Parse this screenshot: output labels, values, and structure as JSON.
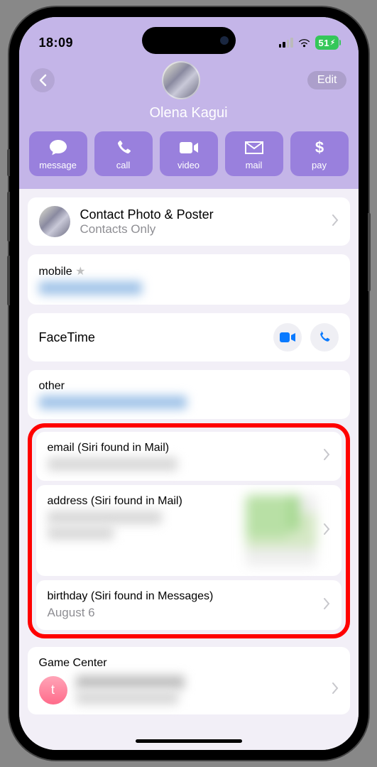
{
  "status": {
    "time": "18:09",
    "battery": "51"
  },
  "header": {
    "edit_label": "Edit",
    "contact_name": "Olena Kagui"
  },
  "actions": {
    "message": "message",
    "call": "call",
    "video": "video",
    "mail": "mail",
    "pay": "pay"
  },
  "photo_poster": {
    "title": "Contact Photo & Poster",
    "subtitle": "Contacts Only"
  },
  "mobile": {
    "label": "mobile"
  },
  "facetime": {
    "title": "FaceTime"
  },
  "other": {
    "label": "other"
  },
  "siri_email": {
    "label": "email (Siri found in Mail)"
  },
  "siri_address": {
    "label": "address (Siri found in Mail)"
  },
  "siri_birthday": {
    "label": "birthday (Siri found in Messages)",
    "value": "August 6"
  },
  "game_center": {
    "title": "Game Center",
    "avatar_letter": "t"
  }
}
